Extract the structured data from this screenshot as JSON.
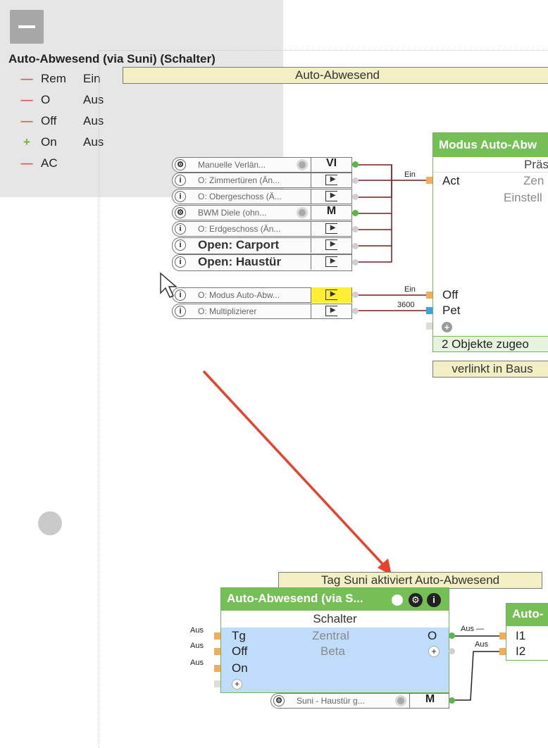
{
  "panel": {
    "title": "Auto-Abwesend (via Suni) (Schalter)",
    "rows": [
      {
        "sign": "—",
        "name": "Rem",
        "value": "Ein"
      },
      {
        "sign": "—",
        "name": "O",
        "value": "Aus"
      },
      {
        "sign": "—",
        "name": "Off",
        "value": "Aus"
      },
      {
        "sign": "+",
        "name": "On",
        "value": "Aus"
      },
      {
        "sign": "—",
        "name": "AC",
        "value": ""
      }
    ]
  },
  "top_label": "Auto-Abwesend",
  "objects": [
    {
      "icon": "⚙",
      "text": "Manuelle Verlän...",
      "target": "VI",
      "has_gear": true
    },
    {
      "icon": "i",
      "text": "O: Zimmertüren (Än...",
      "target": "send",
      "has_gear": false
    },
    {
      "icon": "i",
      "text": "O: Obergeschoss (Ä...",
      "target": "send",
      "has_gear": false
    },
    {
      "icon": "⚙",
      "text": "BWM Diele (ohn...",
      "target": "M",
      "has_gear": true
    },
    {
      "icon": "i",
      "text": "O: Erdgeschoss (Än...",
      "target": "send",
      "has_gear": false
    },
    {
      "icon": "i",
      "text": "Open: Carport",
      "target": "send",
      "has_gear": false
    },
    {
      "icon": "i",
      "text": "Open: Haustür",
      "target": "send",
      "has_gear": false
    },
    {
      "icon": "i",
      "text": "O: Modus Auto-Abw...",
      "target": "send",
      "has_gear": false
    },
    {
      "icon": "i",
      "text": "O: Multiplizierer",
      "target": "send",
      "has_gear": false
    }
  ],
  "modus_block": {
    "title": "Modus Auto-Abw",
    "subtitle": "Präs",
    "inputs": [
      "Act",
      "Off",
      "Pet"
    ],
    "right_texts": [
      "Zen",
      "Einstell"
    ],
    "footer": "2 Objekte zugeo",
    "wire_labels": [
      "Ein",
      "Ein",
      "3600"
    ],
    "link_label": "verlinkt in Baus"
  },
  "tag_label": "Tag Suni aktiviert Auto-Abwesend",
  "schalter_block": {
    "title": "Auto-Abwesend (via S...",
    "subtitle": "Schalter",
    "inputs": [
      "Tg",
      "Off",
      "On"
    ],
    "center_texts": [
      "Zentral",
      "Beta"
    ],
    "output": "O",
    "input_values": [
      "Aus",
      "Aus",
      "Aus"
    ],
    "object": {
      "text": "Suni - Haustür g...",
      "target": "M"
    }
  },
  "right_block": {
    "title": "Auto-",
    "inputs": [
      "I1",
      "I2"
    ],
    "wire_labels": [
      "Aus —",
      "Aus"
    ]
  },
  "colors": {
    "accent_green": "#76bf57",
    "arrow_red": "#e5432f",
    "schalter_bg": "#bfdcfb",
    "label_bg": "#f3efc4"
  }
}
